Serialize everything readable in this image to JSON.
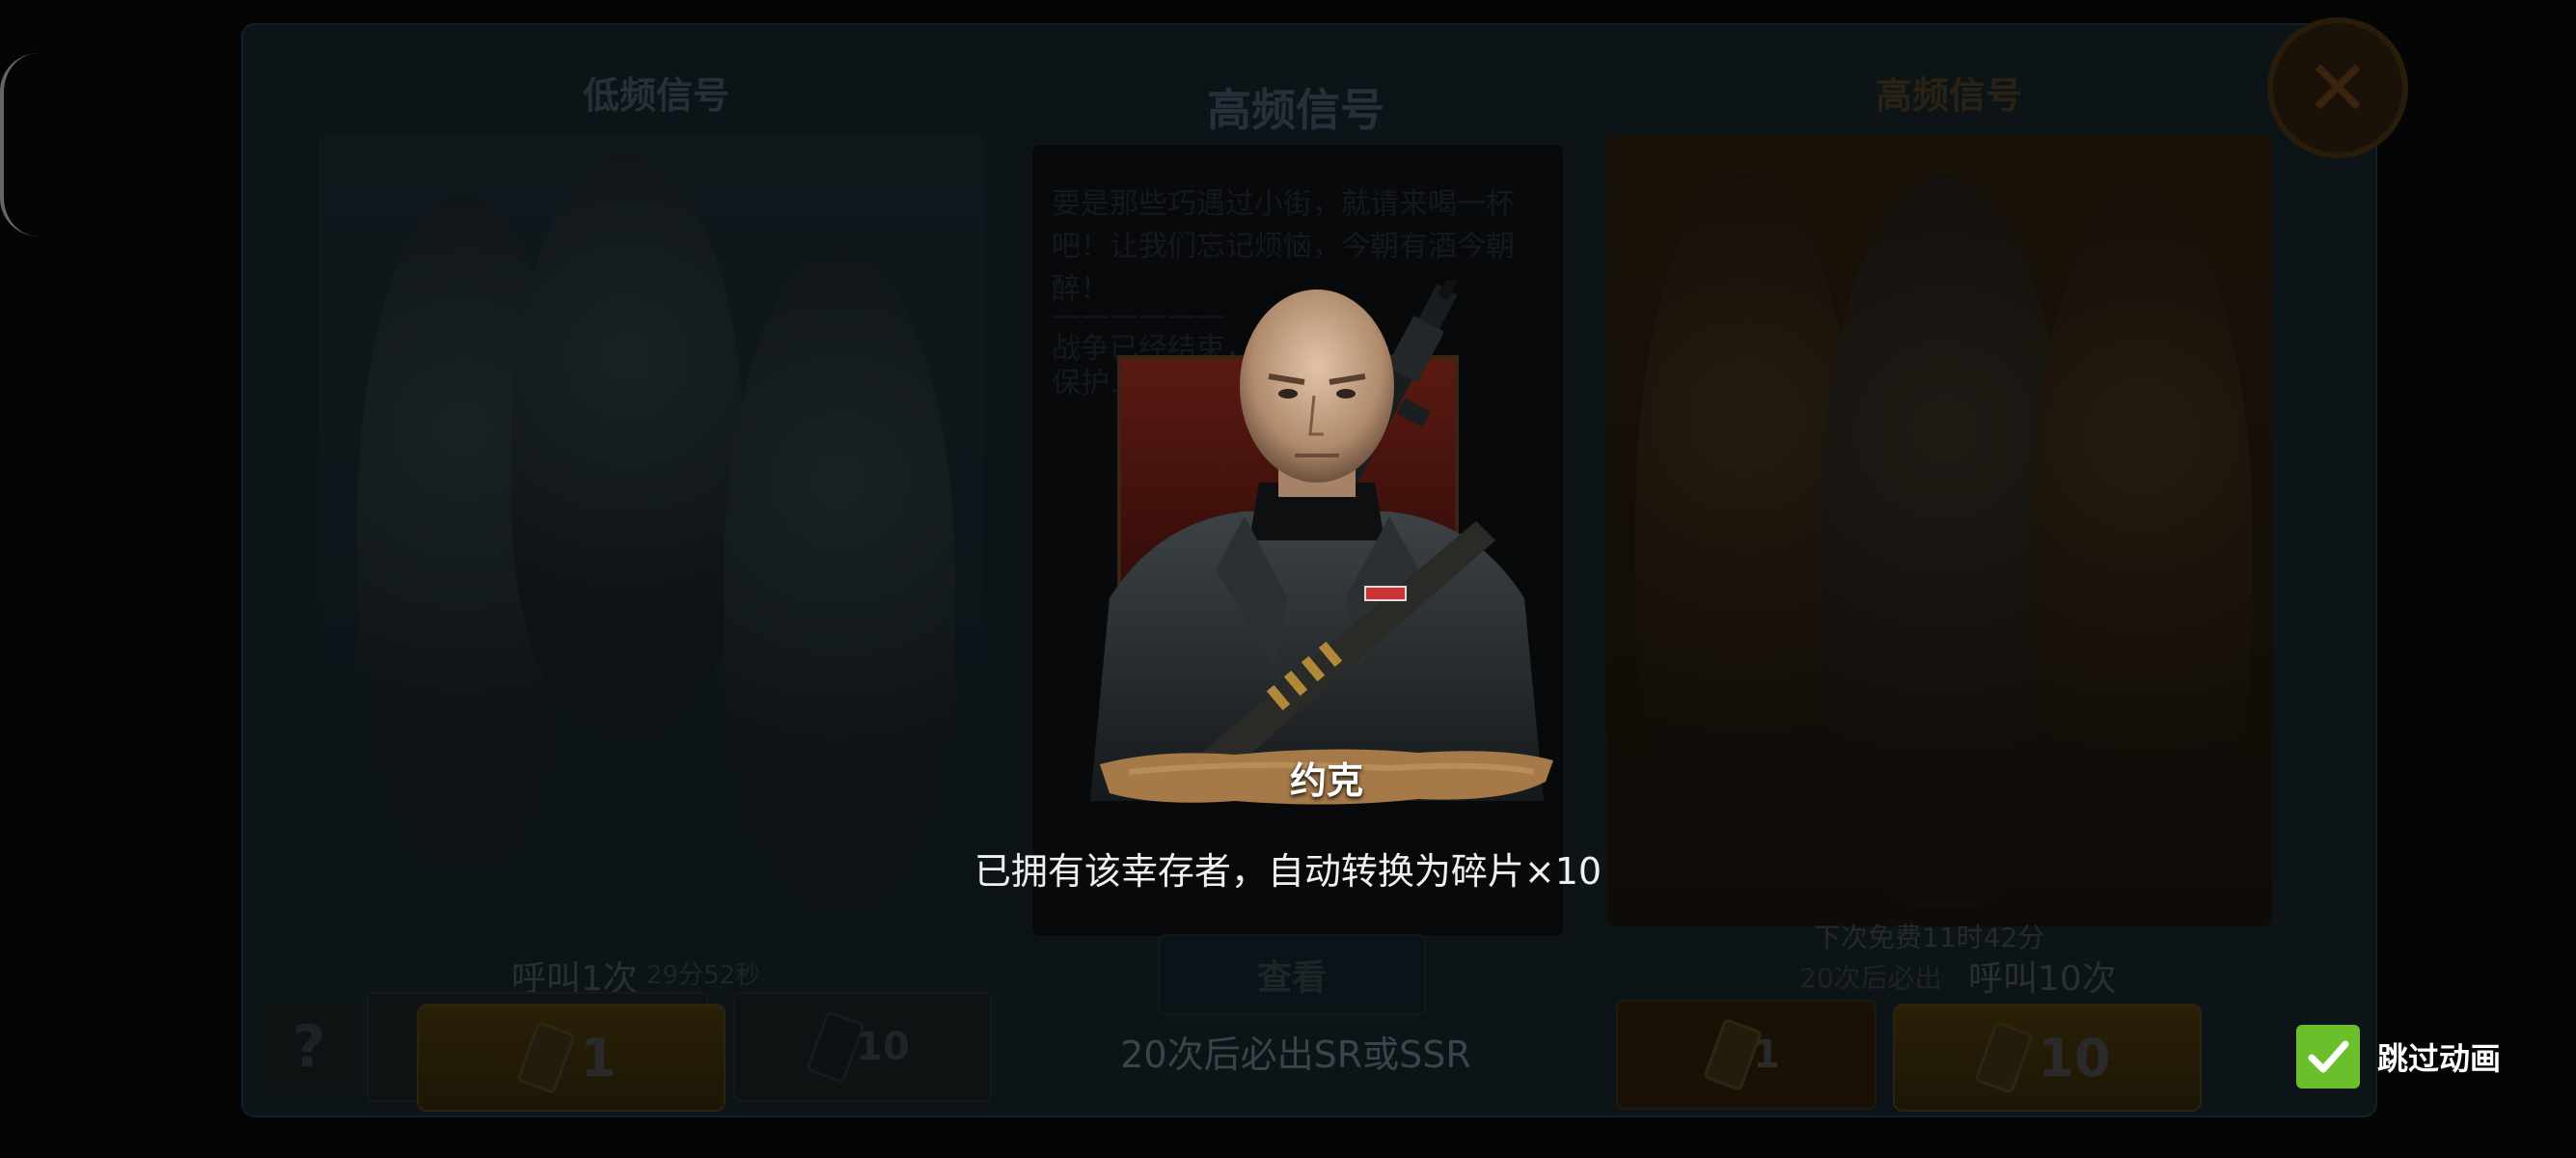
{
  "background": {
    "tabs": {
      "low_freq_title": "低频信号",
      "high_freq_center_title": "高频信号",
      "high_freq_right_title": "高频信号"
    },
    "left_panel": {
      "call_once_label": "呼叫1次",
      "timer_text": "29分52秒",
      "btn_single_count": "1",
      "btn_ten_count": "10"
    },
    "center_panel": {
      "info_lines": [
        "要是那些巧遇过小街，就请来喝一杯",
        "吧！让我们忘记烦恼，今朝有酒今朝",
        "醉！",
        "——————",
        "战争已经结束，……",
        "保护……"
      ],
      "view_button": "查看"
    },
    "right_panel": {
      "free_next_text": "下次免费11时42分",
      "guarantee_small": "20次后必出",
      "call_ten_label": "呼叫10次",
      "btn_single_count": "1",
      "btn_ten_count": "10"
    }
  },
  "overlay": {
    "character_name": "约克",
    "convert_message": "已拥有该幸存者，自动转换为碎片×10",
    "guarantee_text": "20次后必出SR或SSR",
    "skip_animation_label": "跳过动画",
    "skip_animation_checked": true
  },
  "colors": {
    "accent_green": "#6bbf2a",
    "banner_brown": "#a57a48"
  }
}
